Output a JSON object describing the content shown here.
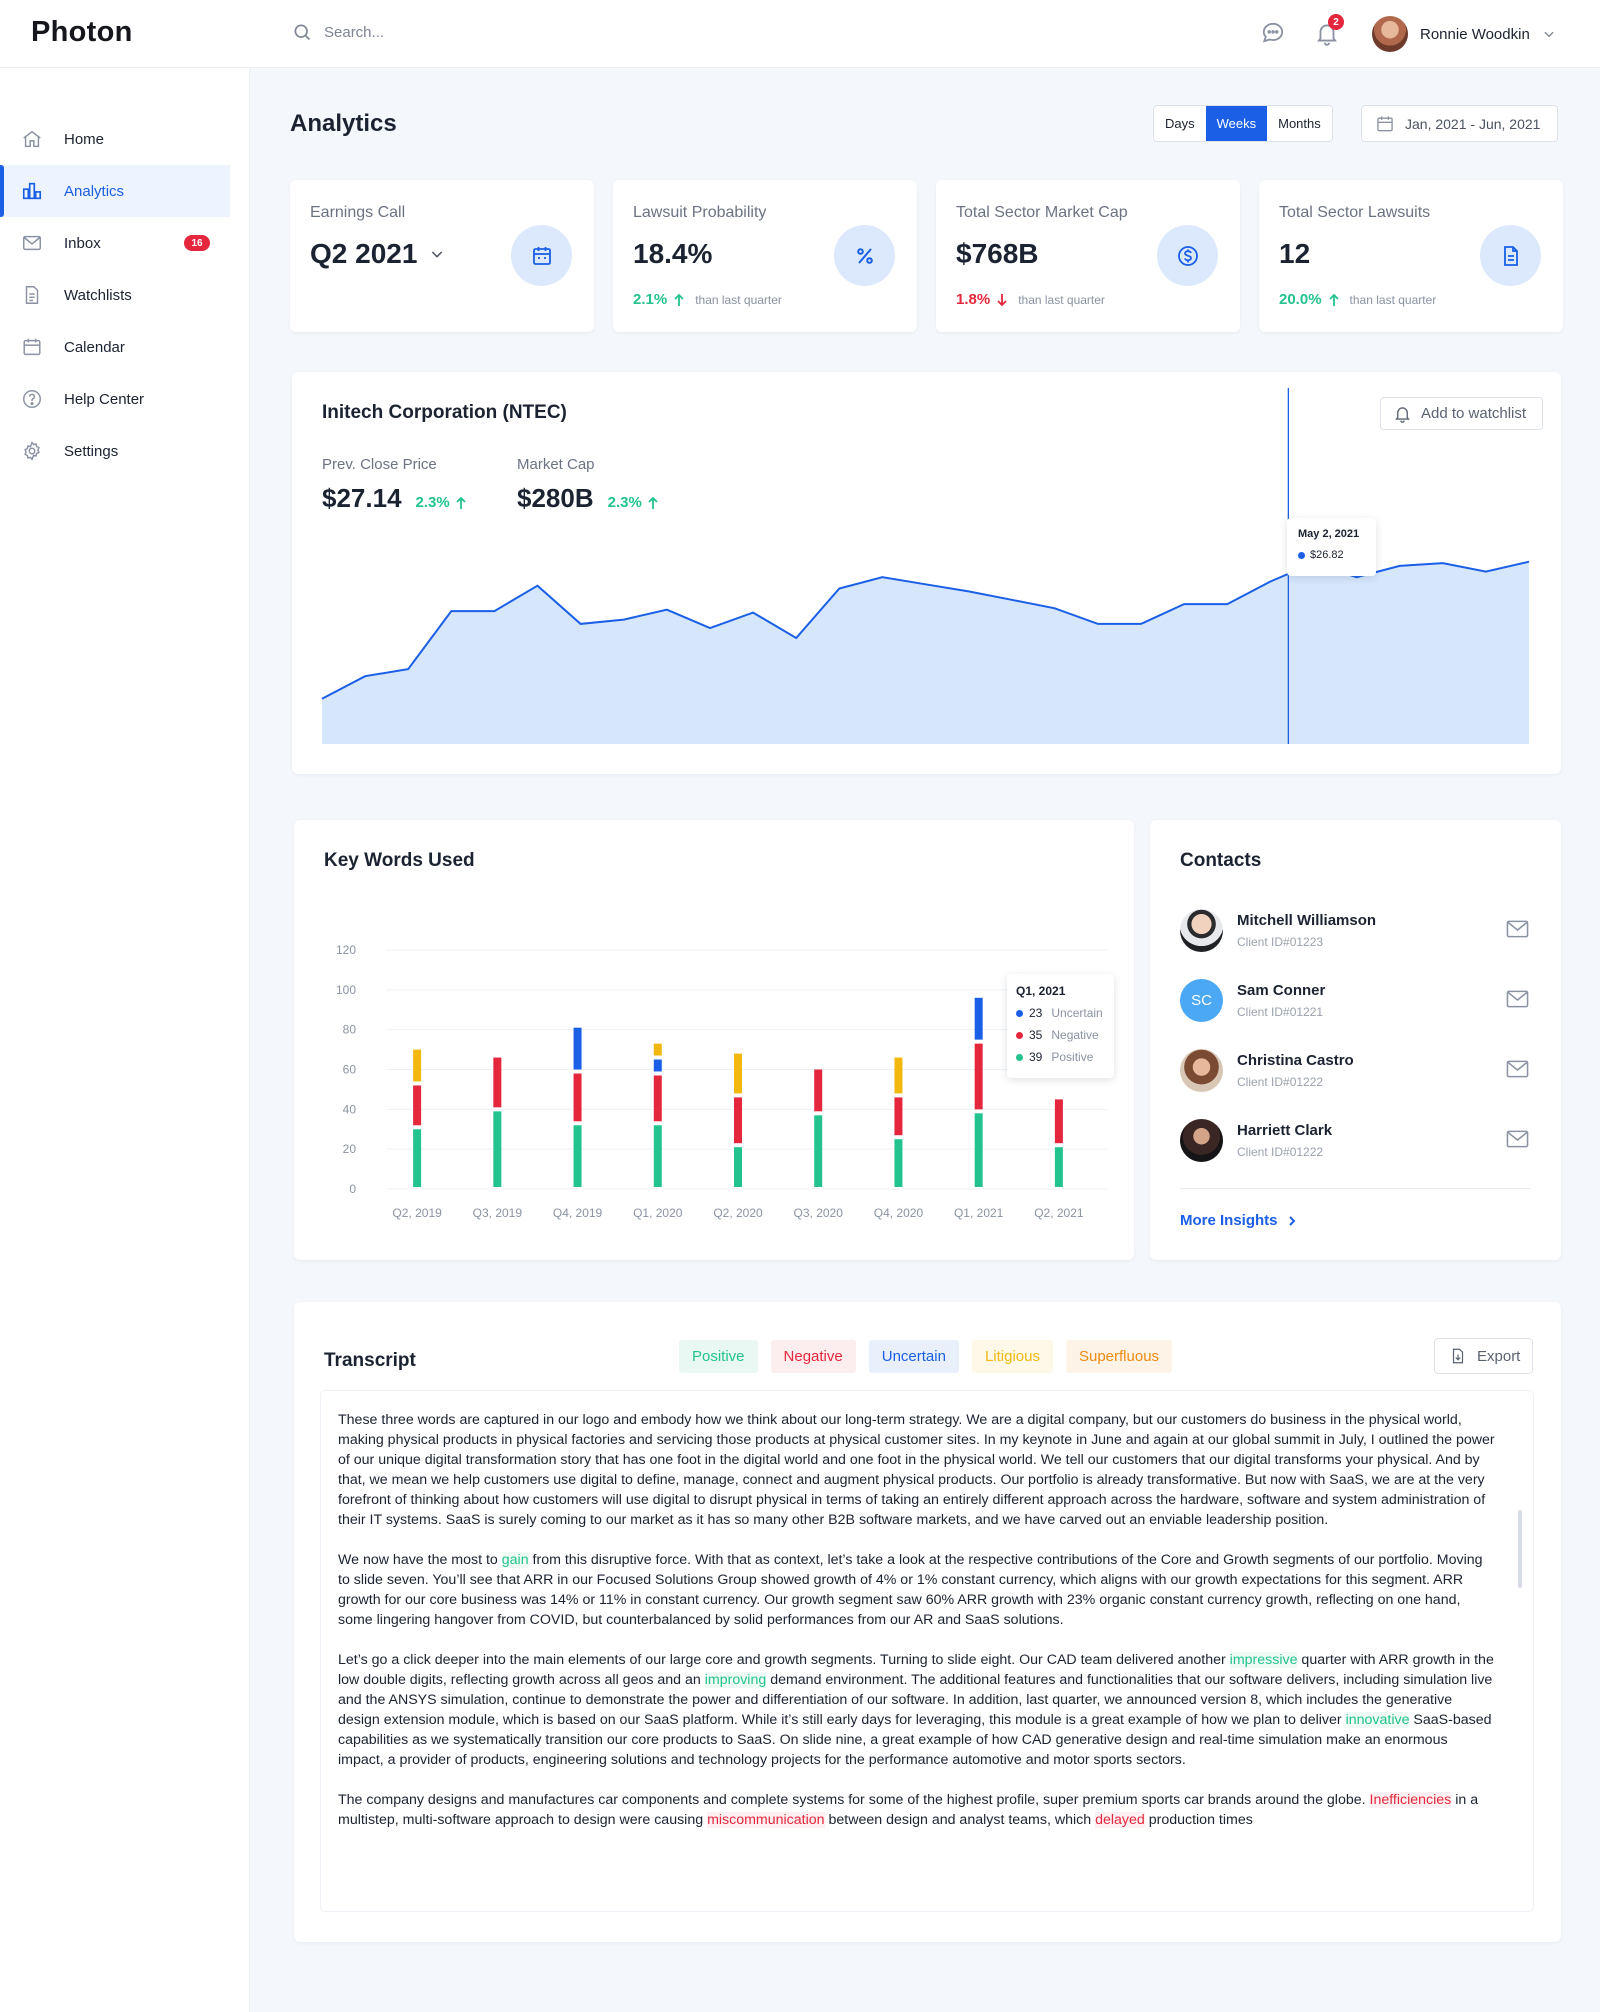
{
  "app": {
    "logo": "Photon"
  },
  "topbar": {
    "search_placeholder": "Search...",
    "notification_count": "2",
    "user_name": "Ronnie Woodkin"
  },
  "sidebar": {
    "items": [
      {
        "label": "Home",
        "icon": "home-icon"
      },
      {
        "label": "Analytics",
        "icon": "bar-chart-icon",
        "active": true
      },
      {
        "label": "Inbox",
        "icon": "mail-icon",
        "badge": "16"
      },
      {
        "label": "Watchlists",
        "icon": "document-icon"
      },
      {
        "label": "Calendar",
        "icon": "calendar-icon"
      },
      {
        "label": "Help Center",
        "icon": "help-icon"
      },
      {
        "label": "Settings",
        "icon": "gear-icon"
      }
    ]
  },
  "header": {
    "title": "Analytics",
    "segments": [
      "Days",
      "Weeks",
      "Months"
    ],
    "active_segment": "Weeks",
    "date_range": "Jan, 2021 - Jun, 2021"
  },
  "stats": [
    {
      "label": "Earnings Call",
      "value": "Q2 2021",
      "icon": "calendar-icon",
      "has_dropdown": true
    },
    {
      "label": "Lawsuit Probability",
      "value": "18.4%",
      "icon": "percent-icon",
      "delta": "2.1%",
      "direction": "up",
      "note": "than last quarter"
    },
    {
      "label": "Total Sector Market Cap",
      "value": "$768B",
      "icon": "dollar-icon",
      "delta": "1.8%",
      "direction": "down",
      "note": "than last quarter"
    },
    {
      "label": "Total Sector Lawsuits",
      "value": "12",
      "icon": "file-icon",
      "delta": "20.0%",
      "direction": "up",
      "note": "than last quarter"
    }
  ],
  "stock": {
    "title": "Initech Corporation (NTEC)",
    "watch_label": "Add to watchlist",
    "prev_close_label": "Prev. Close Price",
    "prev_close_value": "$27.14",
    "prev_close_delta": "2.3%",
    "market_cap_label": "Market Cap",
    "market_cap_value": "$280B",
    "market_cap_delta": "2.3%",
    "tooltip_date": "May 2, 2021",
    "tooltip_value": "$26.82",
    "accent": "#1A5FE6",
    "fill": "#D6E6FB"
  },
  "keywords": {
    "title": "Key Words Used",
    "tooltip": {
      "title": "Q1, 2021",
      "rows": [
        {
          "value": "23",
          "label": "Uncertain",
          "color": "#1A5FE6"
        },
        {
          "value": "35",
          "label": "Negative",
          "color": "#E5273D"
        },
        {
          "value": "39",
          "label": "Positive",
          "color": "#22C38E"
        }
      ]
    }
  },
  "chart_data": [
    {
      "type": "area",
      "title": "Initech Corporation (NTEC)",
      "xlabel": "",
      "ylabel": "",
      "x": [
        1,
        2,
        3,
        4,
        5,
        6,
        7,
        8,
        9,
        10,
        11,
        12,
        13,
        14,
        15,
        16,
        17,
        18,
        19,
        20,
        21,
        22,
        23,
        24,
        25,
        26,
        27,
        28,
        29,
        30,
        31,
        32,
        33,
        34
      ],
      "values": [
        3.2,
        4.8,
        5.3,
        9.4,
        9.4,
        11.2,
        8.5,
        8.8,
        9.5,
        8.2,
        9.3,
        7.5,
        11.0,
        11.8,
        11.3,
        10.8,
        10.2,
        9.6,
        8.5,
        8.5,
        9.9,
        9.9,
        11.5,
        12.8,
        11.8,
        12.6,
        12.8,
        12.2,
        12.9
      ],
      "highlight": {
        "label": "May 2, 2021",
        "value": "$26.82"
      },
      "grid": false
    },
    {
      "type": "bar",
      "stacked": true,
      "title": "Key Words Used",
      "categories": [
        "Q2, 2019",
        "Q3, 2019",
        "Q4, 2019",
        "Q1, 2020",
        "Q2, 2020",
        "Q3, 2020",
        "Q4, 2020",
        "Q1, 2021",
        "Q2, 2021"
      ],
      "series": [
        {
          "name": "Positive",
          "color": "#22C38E",
          "values": [
            31,
            40,
            33,
            33,
            22,
            38,
            26,
            39,
            22
          ]
        },
        {
          "name": "Negative",
          "color": "#E5273D",
          "values": [
            22,
            27,
            26,
            25,
            25,
            23,
            21,
            35,
            24
          ]
        },
        {
          "name": "Uncertain",
          "color": "#1A5FE6",
          "values": [
            0,
            0,
            23,
            8,
            0,
            0,
            0,
            23,
            0
          ]
        },
        {
          "name": "Litigious",
          "color": "#F2B80F",
          "values": [
            18,
            0,
            0,
            8,
            22,
            0,
            20,
            0,
            0
          ]
        }
      ],
      "ylim": [
        0,
        120
      ],
      "yticks": [
        "0",
        "20",
        "40",
        "60",
        "80",
        "100",
        "120"
      ],
      "grid": true
    }
  ],
  "contacts": {
    "title": "Contacts",
    "items": [
      {
        "name": "Mitchell Williamson",
        "id": "Client ID#01223",
        "avatar": "photo"
      },
      {
        "name": "Sam Conner",
        "id": "Client ID#01221",
        "avatar": "SC"
      },
      {
        "name": "Christina Castro",
        "id": "Client ID#01222",
        "avatar": "photo"
      },
      {
        "name": "Harriett Clark",
        "id": "Client ID#01222",
        "avatar": "photo"
      }
    ],
    "more_label": "More Insights"
  },
  "transcript": {
    "title": "Transcript",
    "chips": [
      "Positive",
      "Negative",
      "Uncertain",
      "Litigious",
      "Superfluous"
    ],
    "export_label": "Export",
    "paragraphs": [
      [
        {
          "t": "These three words are captured in our logo and embody how we think about our long-term strategy. We are a digital company, but our customers do business in the physical world, making physical products in physical factories and servicing those products at physical customer sites. In my keynote in June and again at our global summit in July, I outlined the power of our unique digital transformation story that has one foot in the digital world and one foot in the physical world. We tell our customers that our digital transforms your physical. And by that, we mean we help customers use digital to define, manage, connect and augment physical products. Our portfolio is already transformative. But now with SaaS, we are at the very forefront of thinking about how customers will use digital to disrupt physical in terms of taking an entirely different approach across the hardware, software and system administration of their IT systems. SaaS is surely coming to our market as it has so many other B2B software markets, and we have carved out an enviable leadership position."
        }
      ],
      [
        {
          "t": "We now have the most to "
        },
        {
          "t": "gain",
          "h": "pos"
        },
        {
          "t": " from this disruptive force. With that as context, let’s take a look at the respective contributions of the Core and Growth segments of our portfolio. Moving to slide seven. You’ll see that ARR in our Focused Solutions Group showed growth of 4% or 1% constant currency, which aligns with our growth expectations for this segment. ARR growth for our core business was 14% or 11% in constant currency. Our growth segment saw 60% ARR growth with 23% organic constant currency growth, reflecting on one hand, some lingering hangover from COVID, but counterbalanced by solid performances from our AR and SaaS solutions."
        }
      ],
      [
        {
          "t": "Let’s go a click deeper into the main elements of our large core and growth segments. Turning to slide eight. Our CAD team delivered another "
        },
        {
          "t": "impressive",
          "h": "pos"
        },
        {
          "t": " quarter with ARR growth in the low double digits, reflecting growth across all geos and an "
        },
        {
          "t": "improving",
          "h": "pos"
        },
        {
          "t": " demand environment. The additional features and functionalities that our software delivers, including simulation live and the ANSYS simulation, continue to demonstrate the power and differentiation of our software. In addition, last quarter, we announced version 8, which includes the generative design extension module, which is based on our SaaS platform. While it’s still early days for leveraging, this module is a great example of how we plan to deliver "
        },
        {
          "t": "innovative",
          "h": "pos"
        },
        {
          "t": " SaaS-based capabilities as we systematically transition our core products to SaaS. On slide nine, a great example of how CAD generative design and real-time simulation make an enormous impact, a provider of products, engineering solutions and technology projects for the performance automotive and motor sports sectors."
        }
      ],
      [
        {
          "t": "The company designs and manufactures car components and complete systems for some of the highest profile, super premium sports car brands around the globe. "
        },
        {
          "t": "Inefficiencies",
          "h": "neg"
        },
        {
          "t": " in a multistep, multi-software approach to design were causing "
        },
        {
          "t": "miscommunication",
          "h": "neg"
        },
        {
          "t": " between design and analyst teams, which "
        },
        {
          "t": "delayed",
          "h": "neg"
        },
        {
          "t": " production times"
        }
      ]
    ]
  }
}
